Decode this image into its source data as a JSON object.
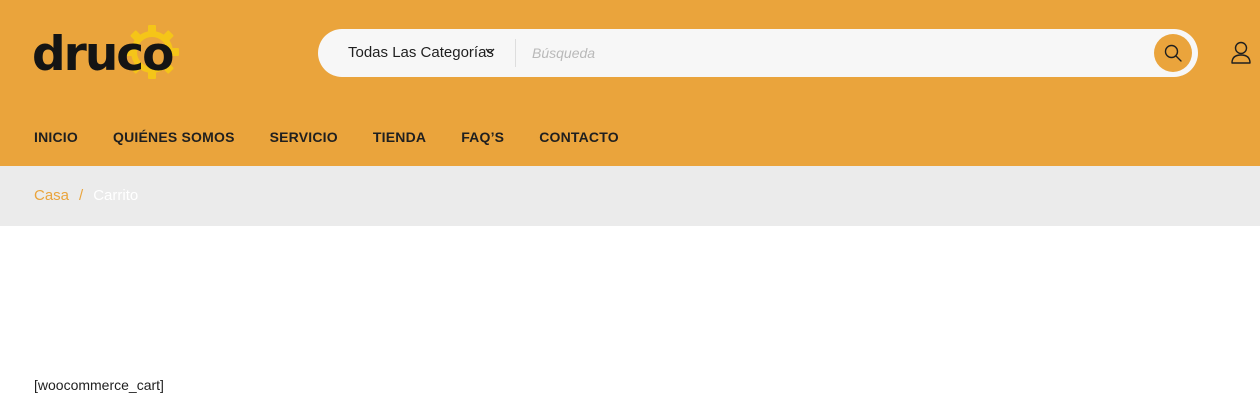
{
  "brand": {
    "logo_text": "druco",
    "accent_color": "#eaa43c"
  },
  "search": {
    "category_selected": "Todas Las Categorías",
    "placeholder": "Búsqueda",
    "value": "",
    "search_icon": "search-icon",
    "chevron_icon": "chevron-down-icon"
  },
  "account": {
    "icon": "user-icon"
  },
  "nav": {
    "items": [
      {
        "label": "INICIO"
      },
      {
        "label": "QUIÉNES SOMOS"
      },
      {
        "label": "SERVICIO"
      },
      {
        "label": "TIENDA"
      },
      {
        "label": "FAQ’S"
      },
      {
        "label": "CONTACTO"
      }
    ]
  },
  "breadcrumb": {
    "home": "Casa",
    "separator": "/",
    "current": "Carrito"
  },
  "content": {
    "shortcode": "[woocommerce_cart]"
  }
}
